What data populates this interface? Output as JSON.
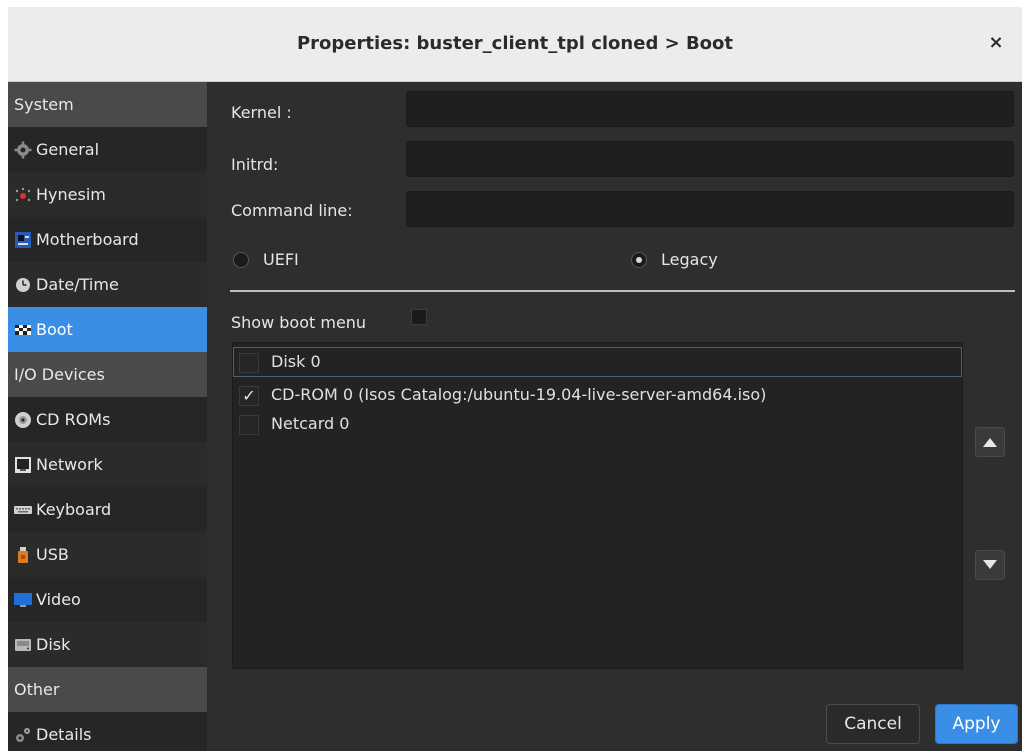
{
  "window": {
    "title": "Properties: buster_client_tpl cloned > Boot",
    "close_glyph": "×"
  },
  "sidebar": {
    "sections": [
      {
        "header": "System",
        "items": [
          {
            "label": "General",
            "icon": "gear-icon"
          },
          {
            "label": "Hynesim",
            "icon": "hynesim-icon"
          },
          {
            "label": "Motherboard",
            "icon": "motherboard-icon"
          },
          {
            "label": "Date/Time",
            "icon": "clock-icon"
          },
          {
            "label": "Boot",
            "icon": "boot-flag-icon",
            "selected": true
          }
        ]
      },
      {
        "header": "I/O Devices",
        "items": [
          {
            "label": "CD ROMs",
            "icon": "cdrom-icon"
          },
          {
            "label": "Network",
            "icon": "network-icon"
          },
          {
            "label": "Keyboard",
            "icon": "keyboard-icon"
          },
          {
            "label": "USB",
            "icon": "usb-icon"
          },
          {
            "label": "Video",
            "icon": "video-icon"
          },
          {
            "label": "Disk",
            "icon": "disk-icon"
          }
        ]
      },
      {
        "header": "Other",
        "items": [
          {
            "label": "Details",
            "icon": "details-gear-icon"
          }
        ]
      }
    ]
  },
  "form": {
    "kernel_label": "Kernel :",
    "kernel_value": "",
    "initrd_label": "Initrd:",
    "initrd_value": "",
    "cmdline_label": "Command line:",
    "cmdline_value": "",
    "uefi_label": "UEFI",
    "legacy_label": "Legacy",
    "firmware_selected": "Legacy",
    "show_boot_menu_label": "Show boot menu",
    "show_boot_menu_checked": false
  },
  "boot_order": [
    {
      "label": "Disk 0",
      "checked": false,
      "check_glyph": ""
    },
    {
      "label": "CD-ROM 0 (Isos Catalog:/ubuntu-19.04-live-server-amd64.iso)",
      "checked": true,
      "check_glyph": "✓"
    },
    {
      "label": "Netcard 0",
      "checked": false,
      "check_glyph": ""
    }
  ],
  "buttons": {
    "cancel": "Cancel",
    "apply": "Apply"
  },
  "colors": {
    "accent": "#3a8ee6",
    "background": "#2e2e2e",
    "sidebar_header": "#4a4a4a"
  }
}
